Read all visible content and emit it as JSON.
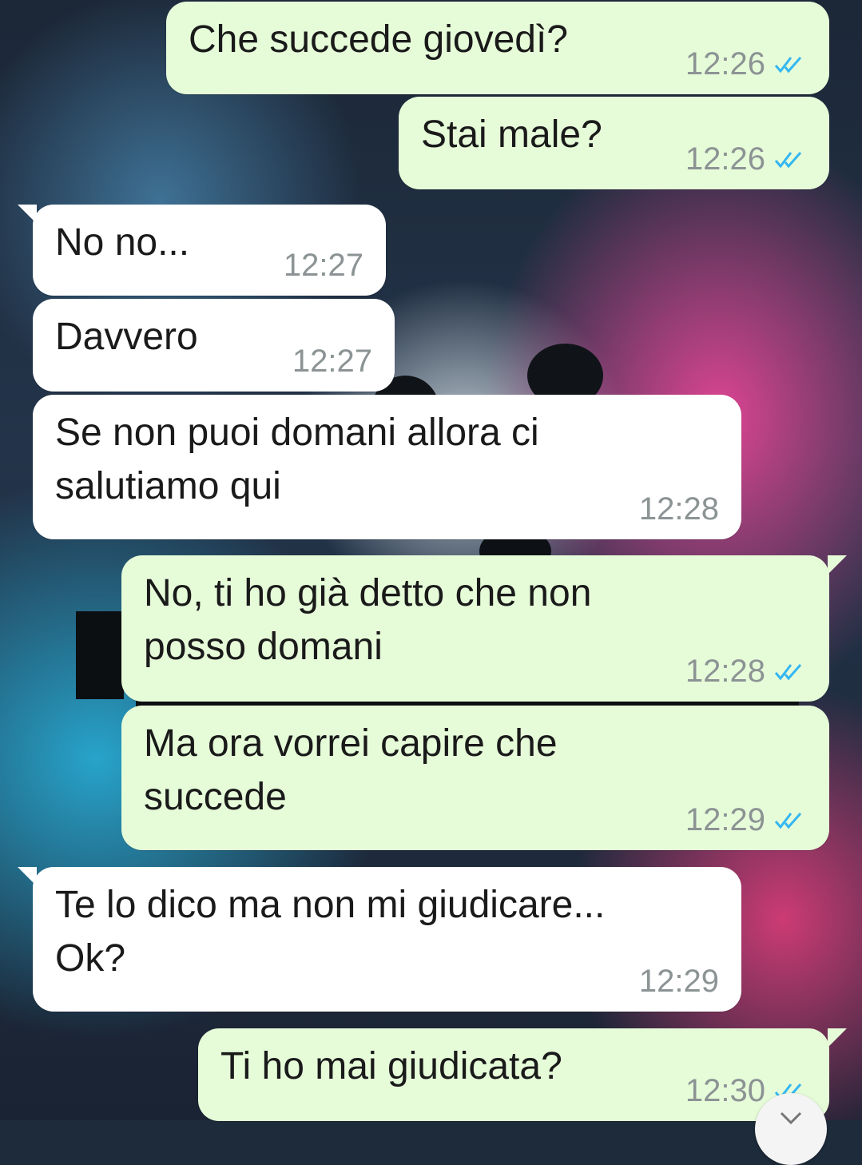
{
  "messages": [
    {
      "dir": "out",
      "text": "Che succede giovedì?",
      "time": "12:26",
      "status": "read"
    },
    {
      "dir": "out",
      "text": "Stai male?",
      "time": "12:26",
      "status": "read"
    },
    {
      "dir": "in",
      "text": "No no...",
      "time": "12:27"
    },
    {
      "dir": "in",
      "text": "Davvero",
      "time": "12:27"
    },
    {
      "dir": "in",
      "text": "Se non puoi domani allora ci\nsalutiamo qui",
      "time": "12:28"
    },
    {
      "dir": "out",
      "text": "No, ti ho già detto che non\nposso domani",
      "time": "12:28",
      "status": "read"
    },
    {
      "dir": "out",
      "text": "Ma ora vorrei capire che\nsuccede",
      "time": "12:29",
      "status": "read"
    },
    {
      "dir": "in",
      "text": "Te lo dico ma non mi giudicare...\nOk?",
      "time": "12:29"
    },
    {
      "dir": "out",
      "text": "Ti ho mai giudicata?",
      "time": "12:30",
      "status": "read"
    }
  ],
  "icons": {
    "read_receipt": "double-check-icon",
    "scroll_down": "chevron-down-icon"
  },
  "colors": {
    "outgoing_bubble": "#e6fcd9",
    "incoming_bubble": "#ffffff",
    "read_tick": "#34b7f1",
    "timestamp": "#8c9394"
  }
}
